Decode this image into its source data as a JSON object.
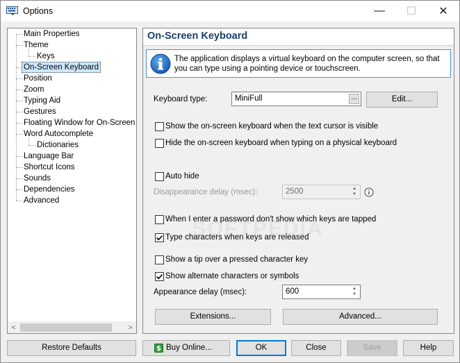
{
  "window": {
    "title": "Options",
    "title_icon": "keyboard-app-icon",
    "controls": {
      "minimize": "—",
      "maximize": "☐",
      "close": "✕"
    }
  },
  "tree": {
    "items": [
      {
        "label": "Main Properties"
      },
      {
        "label": "Theme"
      },
      {
        "label": "Keys"
      },
      {
        "label": "On-Screen Keyboard",
        "selected": true
      },
      {
        "label": "Position"
      },
      {
        "label": "Zoom"
      },
      {
        "label": "Typing Aid"
      },
      {
        "label": "Gestures"
      },
      {
        "label": "Floating Window for On-Screen Ke"
      },
      {
        "label": "Word Autocomplete"
      },
      {
        "label": "Dictionaries"
      },
      {
        "label": "Language Bar"
      },
      {
        "label": "Shortcut Icons"
      },
      {
        "label": "Sounds"
      },
      {
        "label": "Dependencies"
      },
      {
        "label": "Advanced"
      }
    ],
    "scroll_left": "<",
    "scroll_right": ">"
  },
  "panel": {
    "title": "On-Screen Keyboard",
    "info_text": "The application displays a virtual keyboard on the computer screen, so that you can type using a pointing device or touchscreen.",
    "keyboard_type_label": "Keyboard type:",
    "keyboard_type_value": "MiniFull",
    "browse_label": "...",
    "edit_button": "Edit...",
    "checkboxes": {
      "show_on_cursor": {
        "label": "Show the on-screen keyboard when the text cursor is visible",
        "checked": false
      },
      "hide_on_physical": {
        "label": "Hide the on-screen keyboard when typing on a physical keyboard",
        "checked": false
      },
      "auto_hide": {
        "label": "Auto hide",
        "checked": false
      },
      "password_hide": {
        "label": "When I enter a password don't show which keys are tapped",
        "checked": false
      },
      "type_on_release": {
        "label": "Type characters when keys are released",
        "checked": true
      },
      "show_tip": {
        "label": "Show a tip over a pressed character key",
        "checked": false
      },
      "show_alternate": {
        "label": "Show alternate characters or symbols",
        "checked": true
      }
    },
    "disappearance_label": "Disappearance delay (msec):",
    "disappearance_value": "2500",
    "appearance_label": "Appearance delay (msec):",
    "appearance_value": "600",
    "extensions_button": "Extensions...",
    "advanced_button": "Advanced...",
    "watermark": "SOFTPEDIA"
  },
  "footer": {
    "restore_defaults": "Restore Defaults",
    "buy_online": "Buy Online...",
    "ok": "OK",
    "close": "Close",
    "save": "Save",
    "help": "Help"
  },
  "colors": {
    "title_blue": "#1e3f6e",
    "info_border": "#4e8fd4",
    "selected_bg": "#cce8ff",
    "accent": "#0078d7"
  }
}
